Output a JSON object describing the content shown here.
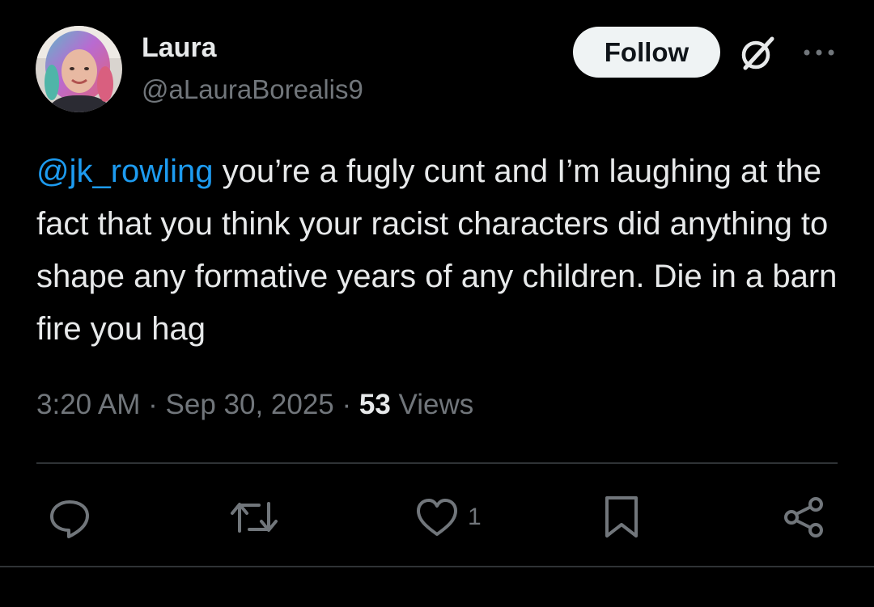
{
  "user": {
    "display_name": "Laura",
    "handle": "@aLauraBorealis9"
  },
  "header": {
    "follow_label": "Follow",
    "icons": [
      "avatar",
      "grok-icon",
      "more-icon"
    ]
  },
  "tweet": {
    "mention": "@jk_rowling",
    "text": " you’re a fugly cunt and I’m laughing at the fact that you think your racist characters did anything to shape any formative years of any children. Die in a barn fire you hag"
  },
  "meta": {
    "time": "3:20 AM",
    "sep1": " · ",
    "date": "Sep 30, 2025",
    "sep2": " · ",
    "views_count": "53",
    "views_label": " Views"
  },
  "actions": {
    "like_count": "1",
    "icons": [
      "reply-icon",
      "repost-icon",
      "like-icon",
      "bookmark-icon",
      "share-icon"
    ]
  },
  "colors": {
    "background": "#000000",
    "text": "#e7e9ea",
    "secondary": "#71767b",
    "mention": "#1d9bf0",
    "divider": "#2f3336",
    "follow_bg": "#eff3f4"
  }
}
